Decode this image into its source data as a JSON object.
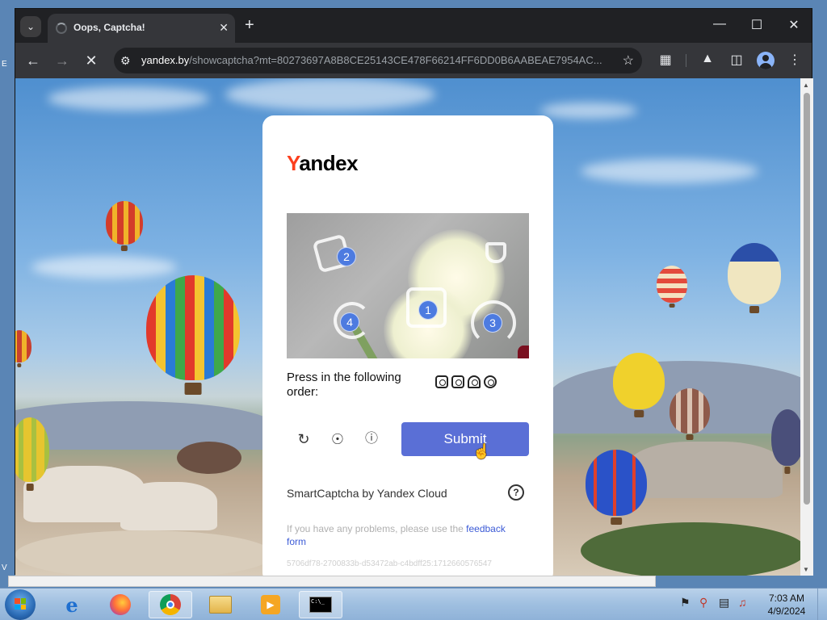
{
  "browser": {
    "tab_title": "Oops, Captcha!",
    "url_host": "yandex.by",
    "url_path": "/showcaptcha?mt=80273697A8B8CE25143CE478F66214FF6DD0B6AABEAE7954AC...",
    "icons": [
      "tab-search-icon",
      "close-icon",
      "plus-icon",
      "minimize-icon",
      "maximize-icon",
      "close-window-icon",
      "back-icon",
      "forward-icon",
      "stop-icon",
      "site-settings-icon",
      "star-icon",
      "extensions-icon",
      "labs-icon",
      "side-panel-icon",
      "profile-icon",
      "menu-icon"
    ]
  },
  "captcha": {
    "logo_first": "Y",
    "logo_rest": "andex",
    "markers": [
      "2",
      "1",
      "4",
      "3"
    ],
    "instruction": "Press in the following order:",
    "submit_label": "Submit",
    "brand": "SmartCaptcha by Yandex Cloud",
    "feedback_text": "If you have any problems, please use the ",
    "feedback_link": "feedback form",
    "hash": "5706df78-2700833b-d53472ab-c4bdff25:1712660576547",
    "accent_color": "#5a6fd6",
    "logo_color": "#fc3f1d"
  },
  "taskbar": {
    "time": "7:03 AM",
    "date": "4/9/2024",
    "apps": [
      "internet-explorer-icon",
      "firefox-icon",
      "chrome-icon",
      "explorer-icon",
      "media-player-icon",
      "cmd-icon"
    ]
  },
  "desktop": {
    "edge_letters": [
      "E",
      "V"
    ]
  }
}
